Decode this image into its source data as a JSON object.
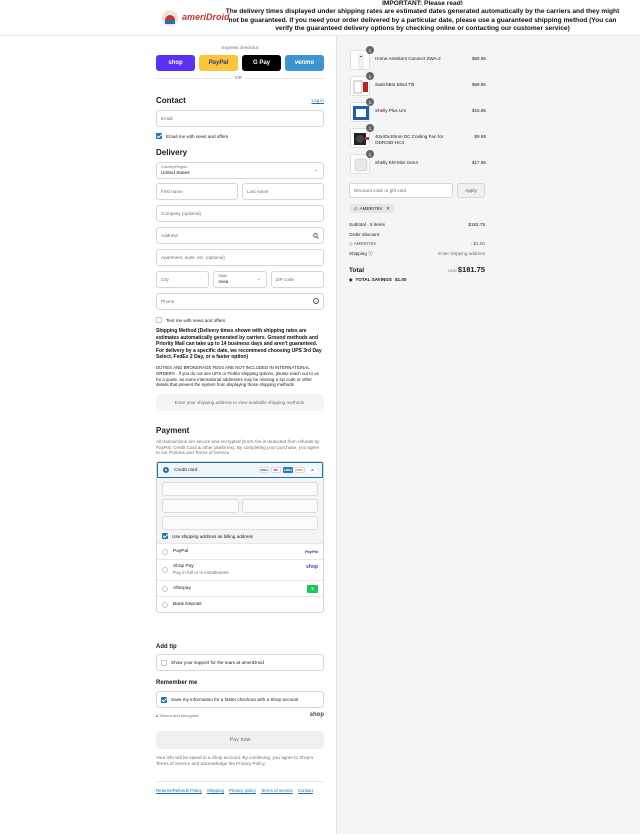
{
  "header": {
    "logo_text": "ameriDroid",
    "notice_title": "IMPORTANT: Please read!",
    "notice_body": "The delivery times displayed under shipping rates are estimated dates generated automatically by the carriers and they might not be guaranteed. If you need your order delivered by a particular date, please use a guaranteed shipping method (You can verify the guaranteed delivery options by checking online or contacting our customer service)"
  },
  "express": {
    "label": "Express checkout",
    "buttons": [
      "shop",
      "PayPal",
      "G Pay",
      "venmo"
    ],
    "or": "OR"
  },
  "contact": {
    "title": "Contact",
    "login": "Log in",
    "email_placeholder": "Email",
    "news_label": "Email me with news and offers"
  },
  "delivery": {
    "title": "Delivery",
    "country_label": "Country/Region",
    "country_value": "United States",
    "first_name": "First name",
    "last_name": "Last name",
    "company": "Company (optional)",
    "address": "Address",
    "apartment": "Apartment, suite, etc. (optional)",
    "city": "City",
    "state_label": "State",
    "state_value": "Iowa",
    "zip": "ZIP code",
    "phone": "Phone",
    "text_label": "Text me with news and offers"
  },
  "shipping": {
    "method_text": "Shipping Method (Delivery times shown with shipping rates are estimates automatically generated by carriers. Ground methods and Priority Mail can take up to 14 business days and aren't guaranteed. For delivery by a specific date, we recommend choosing UPS 3rd Day Select, FedEx 2 Day, or a faster option)",
    "duties_text": "DUTIES AND BROKERAGE FEES ARE NOT INCLUDED IN INTERNATIONAL ORDERS . If you do not see UPS or FedEx shipping options, please reach out to us for a quote, as some international addresses may be missing a zip code or other details that prevent the system from displaying those shipping methods",
    "placeholder": "Enter your shipping address to view available shipping methods."
  },
  "payment": {
    "title": "Payment",
    "note": "All transactions are secure and encrypted (5.5% fee is deducted from refunds by PayPal, Credit Card & other platforms). By completing your purchase, you agree to our Policies and Terms of Service.",
    "credit_card": "Credit card",
    "card_logos": [
      "VISA",
      "MC",
      "AMEX",
      "DISC",
      "+5"
    ],
    "billing_label": "Use shipping address as billing address",
    "paypal": "PayPal",
    "paypal_logo": "PayPal",
    "shoppay": "Shop Pay",
    "shoppay_sub": "Pay in full or in installments",
    "shoppay_logo": "shop",
    "afterpay": "Afterpay",
    "bank": "Bank Deposit"
  },
  "tip": {
    "title": "Add tip",
    "label": "Show your support for the team at ameriDroid"
  },
  "remember": {
    "title": "Remember me",
    "label": "Save my information for a faster checkout with a Shop account",
    "secure": "Secure and encrypted",
    "shop_logo": "shop"
  },
  "pay_now": "Pay now",
  "shop_note": "Your info will be saved to a Shop account. By continuing, you agree to Shop's Terms of Service and acknowledge the Privacy Policy.",
  "footer_links": [
    "Returns/Refunds Policy",
    "Shipping",
    "Privacy policy",
    "Terms of service",
    "Contact"
  ],
  "cart": {
    "items": [
      {
        "qty": "1",
        "name": "Home Assistant Connect ZWA-2",
        "price": "$68.95"
      },
      {
        "qty": "1",
        "name": "SwitchBot Blind Tilt",
        "price": "$69.95"
      },
      {
        "qty": "1",
        "name": "Shelly Plus Uni",
        "price": "$15.95"
      },
      {
        "qty": "1",
        "name": "40x40x10mm DC Cooling Fan for ODROID-HC4",
        "price": "$9.95"
      },
      {
        "qty": "1",
        "name": "Shelly EM Mini Gen4",
        "price": "$17.95"
      }
    ],
    "discount_placeholder": "Discount code or gift card",
    "apply": "Apply",
    "code": "AMERI76V",
    "subtotal_label": "Subtotal · 5 items",
    "subtotal": "$182.75",
    "order_discount": "Order discount",
    "discount_code": "AMERI76V",
    "discount_value": "- $1.00",
    "shipping_label": "Shipping",
    "shipping_value": "Enter shipping address",
    "total_label": "Total",
    "currency": "USD",
    "total": "$181.75",
    "savings_label": "TOTAL SAVINGS",
    "savings": "$1.00"
  }
}
